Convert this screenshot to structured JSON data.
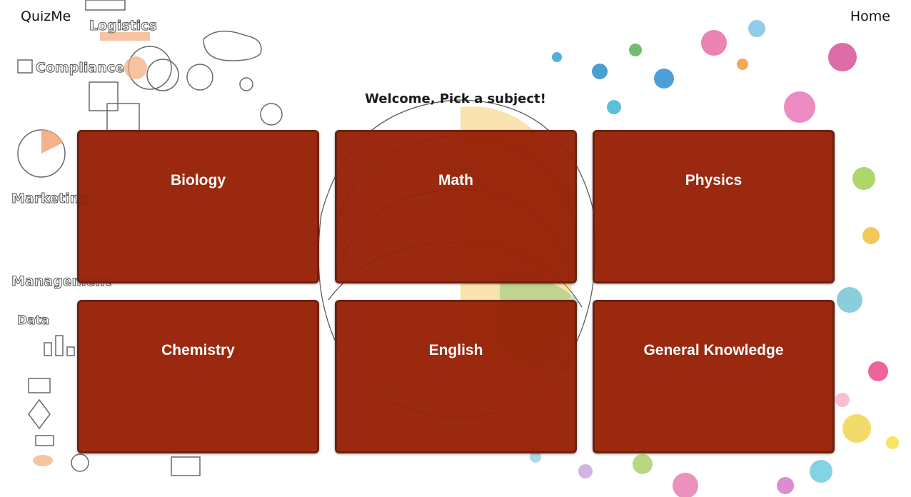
{
  "nav": {
    "brand": "QuizMe",
    "home": "Home"
  },
  "welcome": "Welcome, Pick a subject!",
  "subjects": [
    {
      "label": "Biology"
    },
    {
      "label": "Math"
    },
    {
      "label": "Physics"
    },
    {
      "label": "Chemistry"
    },
    {
      "label": "English"
    },
    {
      "label": "General Knowledge"
    }
  ],
  "background": {
    "sketch_words": [
      "Logistics",
      "Compliance",
      "Marketing",
      "Management",
      "Data"
    ],
    "card_color": "#962006",
    "card_border": "#6b230f"
  }
}
